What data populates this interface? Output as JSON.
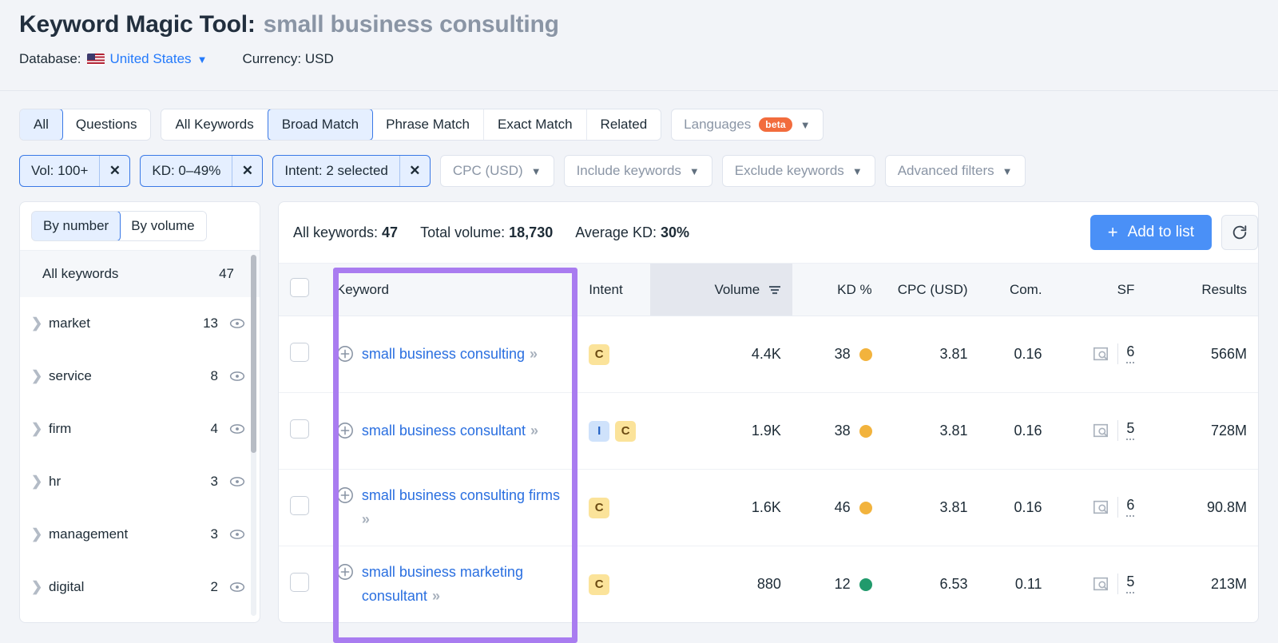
{
  "header": {
    "tool_name": "Keyword Magic Tool:",
    "query": "small business consulting",
    "database_label": "Database:",
    "database_value": "United States",
    "currency_label": "Currency: USD"
  },
  "tabs": {
    "group_one": [
      {
        "label": "All",
        "active": true
      },
      {
        "label": "Questions",
        "active": false
      }
    ],
    "group_two": [
      {
        "label": "All Keywords",
        "active": false
      },
      {
        "label": "Broad Match",
        "active": true
      },
      {
        "label": "Phrase Match",
        "active": false
      },
      {
        "label": "Exact Match",
        "active": false
      },
      {
        "label": "Related",
        "active": false
      }
    ],
    "languages": {
      "label": "Languages",
      "badge": "beta"
    }
  },
  "filters": {
    "active_chips": [
      {
        "label": "Vol: 100+",
        "close": "✕"
      },
      {
        "label": "KD: 0–49%",
        "close": "✕"
      },
      {
        "label": "Intent: 2 selected",
        "close": "✕"
      }
    ],
    "dropdowns": [
      {
        "label": "CPC (USD)"
      },
      {
        "label": "Include keywords"
      },
      {
        "label": "Exclude keywords"
      },
      {
        "label": "Advanced filters"
      }
    ]
  },
  "sidebar": {
    "toggle": [
      {
        "label": "By number",
        "active": true
      },
      {
        "label": "By volume",
        "active": false
      }
    ],
    "all_keywords_label": "All keywords",
    "all_keywords_count": "47",
    "groups": [
      {
        "name": "market",
        "count": "13"
      },
      {
        "name": "service",
        "count": "8"
      },
      {
        "name": "firm",
        "count": "4"
      },
      {
        "name": "hr",
        "count": "3"
      },
      {
        "name": "management",
        "count": "3"
      },
      {
        "name": "digital",
        "count": "2"
      }
    ]
  },
  "summary": {
    "all_keywords_label": "All keywords:",
    "all_keywords_value": "47",
    "total_volume_label": "Total volume:",
    "total_volume_value": "18,730",
    "average_kd_label": "Average KD:",
    "average_kd_value": "30%",
    "add_to_list_label": "Add to list",
    "add_icon": "+",
    "refresh_icon": "refresh-icon"
  },
  "table": {
    "columns": [
      {
        "key": "check",
        "label": ""
      },
      {
        "key": "keyword",
        "label": "Keyword"
      },
      {
        "key": "intent",
        "label": "Intent"
      },
      {
        "key": "volume",
        "label": "Volume",
        "sorted": true
      },
      {
        "key": "kd",
        "label": "KD %"
      },
      {
        "key": "cpc",
        "label": "CPC (USD)"
      },
      {
        "key": "com",
        "label": "Com."
      },
      {
        "key": "sf",
        "label": "SF"
      },
      {
        "key": "results",
        "label": "Results"
      }
    ],
    "rows": [
      {
        "keyword": "small business consulting",
        "intent": [
          "C"
        ],
        "volume": "4.4K",
        "kd": "38",
        "kd_color": "#f2b33d",
        "cpc": "3.81",
        "com": "0.16",
        "sf": "6",
        "results": "566M"
      },
      {
        "keyword": "small business consultant",
        "intent": [
          "I",
          "C"
        ],
        "volume": "1.9K",
        "kd": "38",
        "kd_color": "#f2b33d",
        "cpc": "3.81",
        "com": "0.16",
        "sf": "5",
        "results": "728M"
      },
      {
        "keyword": "small business consulting firms",
        "intent": [
          "C"
        ],
        "volume": "1.6K",
        "kd": "46",
        "kd_color": "#f2b33d",
        "cpc": "3.81",
        "com": "0.16",
        "sf": "6",
        "results": "90.8M"
      },
      {
        "keyword": "small business marketing consultant",
        "intent": [
          "C"
        ],
        "volume": "880",
        "kd": "12",
        "kd_color": "#219a6c",
        "cpc": "6.53",
        "com": "0.11",
        "sf": "5",
        "results": "213M"
      }
    ]
  },
  "annotation": {
    "highlight_color": "#a97cf0",
    "target": "keyword-column"
  }
}
